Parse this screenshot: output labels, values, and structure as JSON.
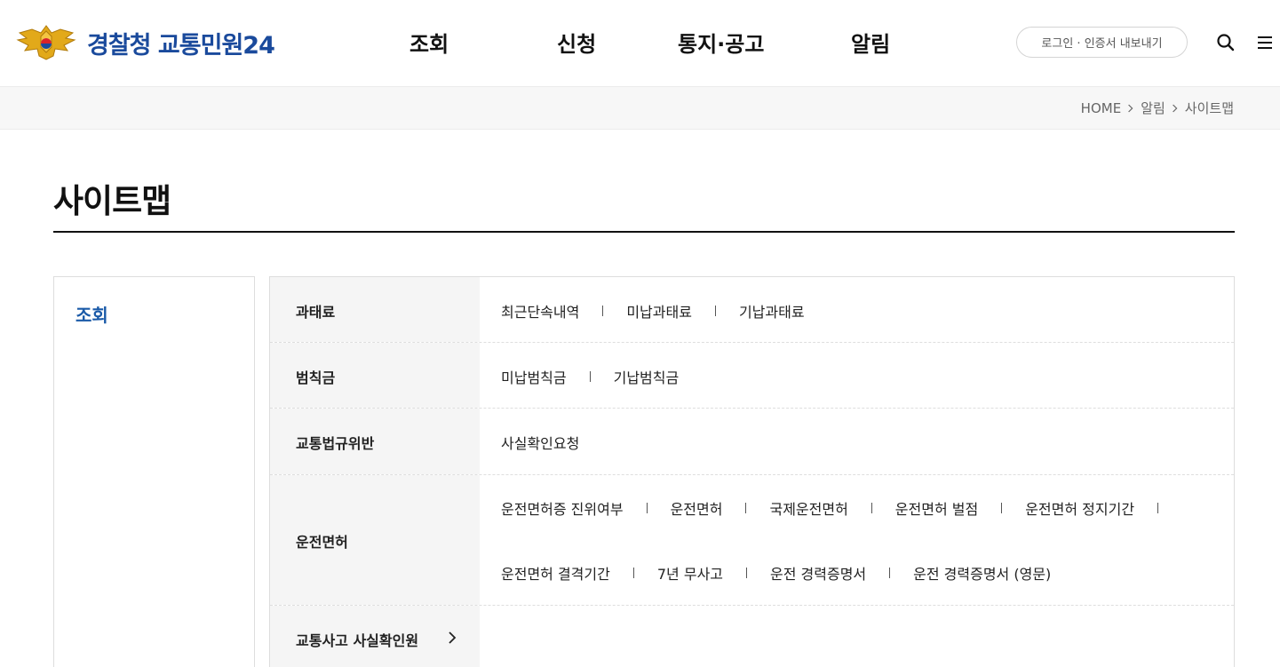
{
  "header": {
    "logo_text": "경찰청 교통민원24",
    "nav": [
      "조회",
      "신청",
      "통지·공고",
      "알림"
    ],
    "login_label": "로그인 · 인증서 내보내기",
    "search_icon": "search-icon",
    "menu_icon": "hamburger-menu-icon"
  },
  "breadcrumb": {
    "items": [
      "HOME",
      "알림",
      "사이트맵"
    ]
  },
  "page": {
    "title": "사이트맵"
  },
  "sitemap": {
    "category": "조회",
    "rows": [
      {
        "label": "과태료",
        "links": [
          [
            "최근단속내역",
            "미납과태료",
            "기납과태료"
          ]
        ]
      },
      {
        "label": "범칙금",
        "links": [
          [
            "미납범칙금",
            "기납범칙금"
          ]
        ]
      },
      {
        "label": "교통법규위반",
        "links": [
          [
            "사실확인요청"
          ]
        ]
      },
      {
        "label": "운전면허",
        "links": [
          [
            "운전면허증 진위여부",
            "운전면허",
            "국제운전면허",
            "운전면허 벌점",
            "운전면허 정지기간"
          ],
          [
            "운전면허 결격기간",
            "7년 무사고",
            "운전 경력증명서",
            "운전 경력증명서 (영문)"
          ]
        ]
      },
      {
        "label": "교통사고 사실확인원",
        "links": []
      }
    ]
  },
  "colors": {
    "brand_blue": "#1a4a9c",
    "category_blue": "#1a5aa8",
    "row_head_bg": "#f5f5f5",
    "location_bg": "#f7f7f7"
  }
}
